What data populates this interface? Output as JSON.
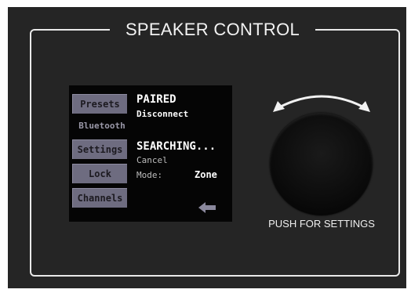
{
  "panel": {
    "title": "SPEAKER CONTROL",
    "knob_caption": "PUSH FOR SETTINGS"
  },
  "screen": {
    "menu": {
      "presets": "Presets",
      "bluetooth": "Bluetooth",
      "settings": "Settings",
      "lock": "Lock",
      "channels": "Channels"
    },
    "paired": {
      "status": "PAIRED",
      "action": "Disconnect"
    },
    "searching": {
      "status": "SEARCHING...",
      "action": "Cancel"
    },
    "mode": {
      "label": "Mode:",
      "value": "Zone"
    }
  },
  "icons": {
    "back": "back-arrow-icon",
    "rotate": "rotate-arrows-icon"
  }
}
